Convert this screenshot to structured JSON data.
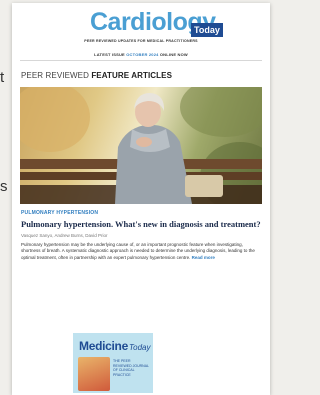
{
  "backdrop": {
    "fragment_1": "t",
    "fragment_2": "s"
  },
  "header": {
    "logo_main": "Cardiology",
    "logo_badge": "Today",
    "tagline": "PEER REVIEWED UPDATES FOR MEDICAL PRACTITIONERS",
    "issue_prefix": "LATEST ISSUE",
    "issue_month": "OCTOBER 2024",
    "issue_suffix": "ONLINE NOW"
  },
  "section": {
    "label_light": "PEER REVIEWED ",
    "label_bold": "FEATURE ARTICLES"
  },
  "article": {
    "category": "PULMONARY HYPERTENSION",
    "title": "Pulmonary hypertension. What's new in diagnosis and treatment?",
    "authors": "Vasquez Sanyo, Andrew Burns, David Prior",
    "summary": "Pulmonary hypertension may be the underlying cause of, or an important prognostic feature when investigating, shortness of breath. A systematic diagnostic approach is needed to determine the underlying diagnosis, leading to the optimal treatment, often in partnership with an expert pulmonary hypertension centre.",
    "read_more": "Read more"
  },
  "promo": {
    "logo_main": "Medicine",
    "logo_badge": "Today",
    "subtitle": "THE PEER REVIEWED JOURNAL OF CLINICAL PRACTICE"
  },
  "colors": {
    "brand_blue": "#4a9fd3",
    "brand_navy": "#1f4c93",
    "accent": "#2f7dbf"
  }
}
